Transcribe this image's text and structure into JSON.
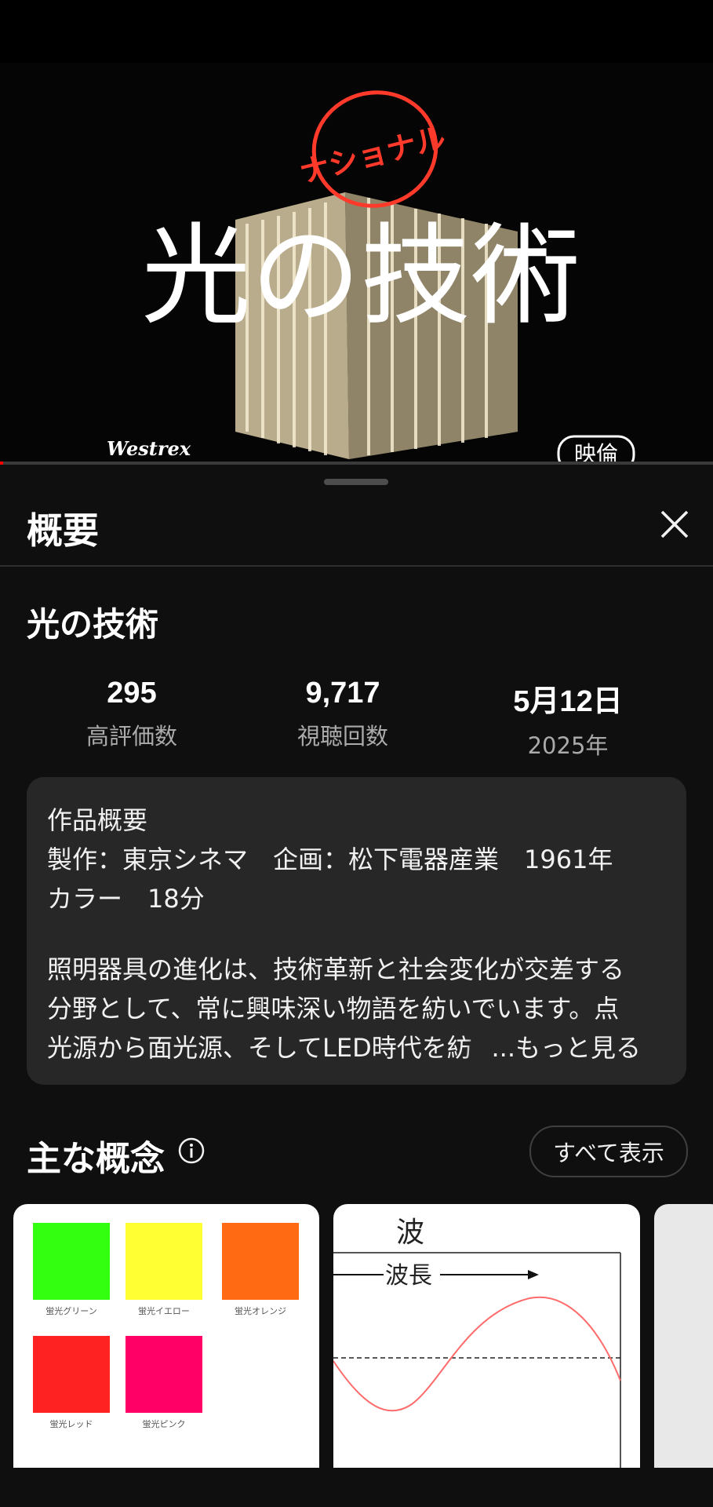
{
  "video": {
    "title_overlay": "光の技術",
    "neon_sign": "ナショナル",
    "credit_left": "Westrex",
    "credit_badge": "映倫",
    "progress_fraction": 0.004
  },
  "sheet": {
    "title": "概要",
    "close_icon": "close-icon"
  },
  "video_title": "光の技術",
  "stats": [
    {
      "value": "295",
      "label": "高評価数"
    },
    {
      "value": "9,717",
      "label": "視聴回数"
    },
    {
      "value": "5月12日",
      "label": "2025年"
    }
  ],
  "description": {
    "lines": [
      "作品概要",
      "製作：東京シネマ　企画：松下電器産業　1961年",
      "カラー　18分",
      "",
      "照明器具の進化は、技術革新と社会変化が交差する",
      "分野として、常に興味深い物語を紡いでいます。点",
      "光源から面光源、そしてLED時代を紡"
    ],
    "more_label": "...もっと見る"
  },
  "concepts": {
    "title": "主な概念",
    "info_icon": "info-icon",
    "show_all_label": "すべて表示",
    "cards": [
      {
        "kind": "swatches",
        "swatches": [
          {
            "color": "#33ff11",
            "label": "蛍光グリーン"
          },
          {
            "color": "#ffff33",
            "label": "蛍光イエロー"
          },
          {
            "color": "#ff6a13",
            "label": "蛍光オレンジ"
          },
          {
            "color": "#ff2222",
            "label": "蛍光レッド"
          },
          {
            "color": "#ff0066",
            "label": "蛍光ピンク"
          }
        ]
      },
      {
        "kind": "wave-diagram",
        "heading": "波",
        "arrow_label": "波長"
      },
      {
        "kind": "partial"
      }
    ]
  }
}
